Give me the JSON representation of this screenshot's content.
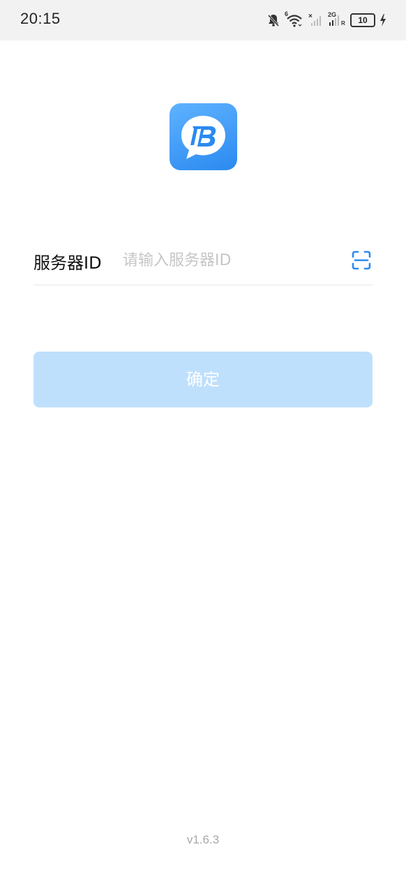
{
  "status_bar": {
    "time": "20:15",
    "icons": [
      "bell-muted-icon",
      "wifi-icon",
      "signal-1-icon",
      "signal-2-icon",
      "battery-icon",
      "charging-icon"
    ],
    "wifi_label": "6",
    "signal2_label": "2G",
    "signal2_sub": "R",
    "battery_level": "10"
  },
  "logo": {
    "icon": "chat-bubble-b-logo",
    "colors": [
      "#5fb2ff",
      "#2b8af0"
    ]
  },
  "form": {
    "server_label": "服务器ID",
    "server_placeholder": "请输入服务器ID",
    "scan_icon": "scan-icon"
  },
  "confirm_label": "确定",
  "version": "v1.6.3",
  "colors": {
    "accent": "#2b8af0",
    "button_disabled": "#bfe0fc",
    "placeholder": "#c6c6c6"
  }
}
